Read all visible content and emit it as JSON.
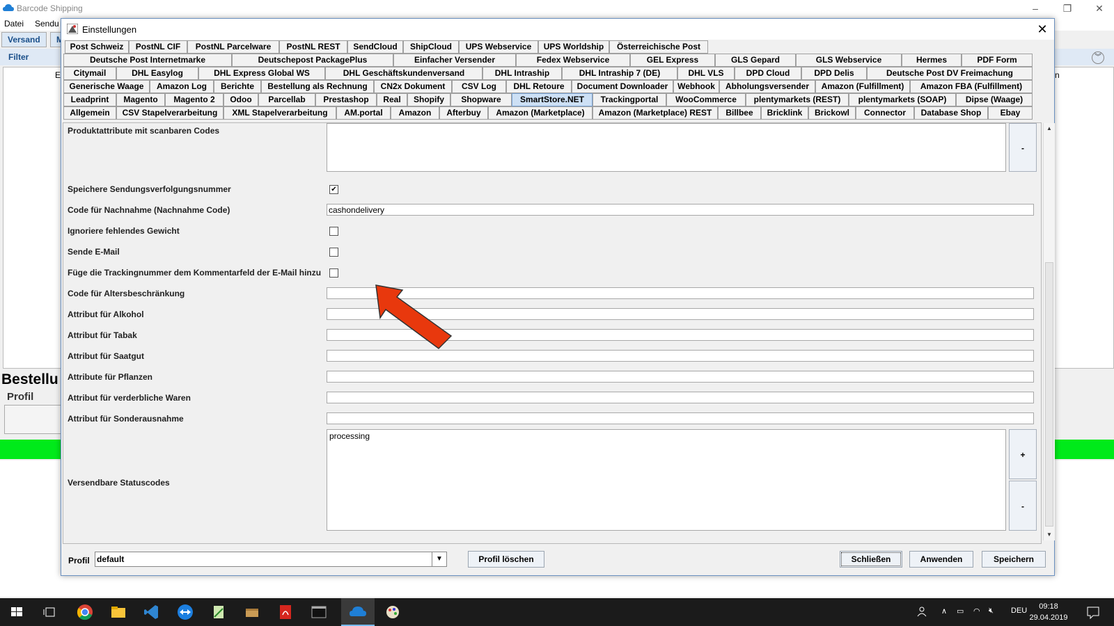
{
  "app": {
    "title": "Barcode Shipping",
    "menu": [
      "Datei",
      "Sendu"
    ],
    "tabs": [
      "Versand",
      "M"
    ],
    "filter_label": "Filter",
    "panel_letter_left": "E",
    "panel_letter_right": "n",
    "bestellung_label": "Bestellu",
    "profil_label": "Profil"
  },
  "dialog": {
    "title": "Einstellungen",
    "tab_rows": [
      [
        "Post Schweiz",
        "PostNL CIF",
        "PostNL Parcelware",
        "PostNL REST",
        "SendCloud",
        "ShipCloud",
        "UPS Webservice",
        "UPS Worldship",
        "Österreichische Post"
      ],
      [
        "Deutsche Post Internetmarke",
        "Deutschepost PackagePlus",
        "Einfacher Versender",
        "Fedex Webservice",
        "GEL Express",
        "GLS Gepard",
        "GLS Webservice",
        "Hermes",
        "PDF Form"
      ],
      [
        "Citymail",
        "DHL Easylog",
        "DHL Express Global WS",
        "DHL Geschäftskundenversand",
        "DHL Intraship",
        "DHL Intraship 7 (DE)",
        "DHL VLS",
        "DPD Cloud",
        "DPD Delis",
        "Deutsche Post DV Freimachung"
      ],
      [
        "Generische Waage",
        "Amazon Log",
        "Berichte",
        "Bestellung als Rechnung",
        "CN2x Dokument",
        "CSV Log",
        "DHL Retoure",
        "Document Downloader",
        "Webhook",
        "Abholungsversender",
        "Amazon (Fulfillment)",
        "Amazon FBA (Fulfillment)"
      ],
      [
        "Leadprint",
        "Magento",
        "Magento 2",
        "Odoo",
        "Parcellab",
        "Prestashop",
        "Real",
        "Shopify",
        "Shopware",
        "SmartStore.NET",
        "Trackingportal",
        "WooCommerce",
        "plentymarkets (REST)",
        "plentymarkets (SOAP)",
        "Dipse (Waage)"
      ],
      [
        "Allgemein",
        "CSV Stapelverarbeitung",
        "XML Stapelverarbeitung",
        "AM.portal",
        "Amazon",
        "Afterbuy",
        "Amazon (Marketplace)",
        "Amazon (Marketplace) REST",
        "Billbee",
        "Bricklink",
        "Brickowl",
        "Connector",
        "Database Shop",
        "Ebay"
      ]
    ],
    "selected_tab": "SmartStore.NET",
    "fields": {
      "produktattribute_label": "Produktattribute mit scanbaren Codes",
      "produktattribute_minus": "-",
      "speichere_label": "Speichere Sendungsverfolgungsnummer",
      "speichere_checked": true,
      "nachnahme_label": "Code für Nachnahme (Nachnahme Code)",
      "nachnahme_value": "cashondelivery",
      "ignoriere_label": "Ignoriere fehlendes Gewicht",
      "sende_label": "Sende E-Mail",
      "fuege_label": "Füge die Trackingnummer dem Kommentarfeld der E-Mail hinzu",
      "alters_label": "Code für Altersbeschränkung",
      "alkohol_label": "Attribut für Alkohol",
      "tabak_label": "Attribut für Tabak",
      "saatgut_label": "Attribut für Saatgut",
      "pflanzen_label": "Attribute für Pflanzen",
      "verderblich_label": "Attribut für verderbliche Waren",
      "sonder_label": "Attribut für Sonderausnahme",
      "status_label": "Versendbare Statuscodes",
      "status_value": "processing",
      "status_plus": "+",
      "status_minus": "-"
    },
    "footer": {
      "profil_label": "Profil",
      "profil_value": "default",
      "delete_button": "Profil löschen",
      "close_button": "Schließen",
      "apply_button": "Anwenden",
      "save_button": "Speichern"
    }
  },
  "taskbar": {
    "language": "DEU",
    "time": "09:18",
    "date": "29.04.2019"
  },
  "colors": {
    "accent_green": "#00ea1a",
    "arrow": "#e8380d",
    "selected_tab": "#cde0f5"
  }
}
